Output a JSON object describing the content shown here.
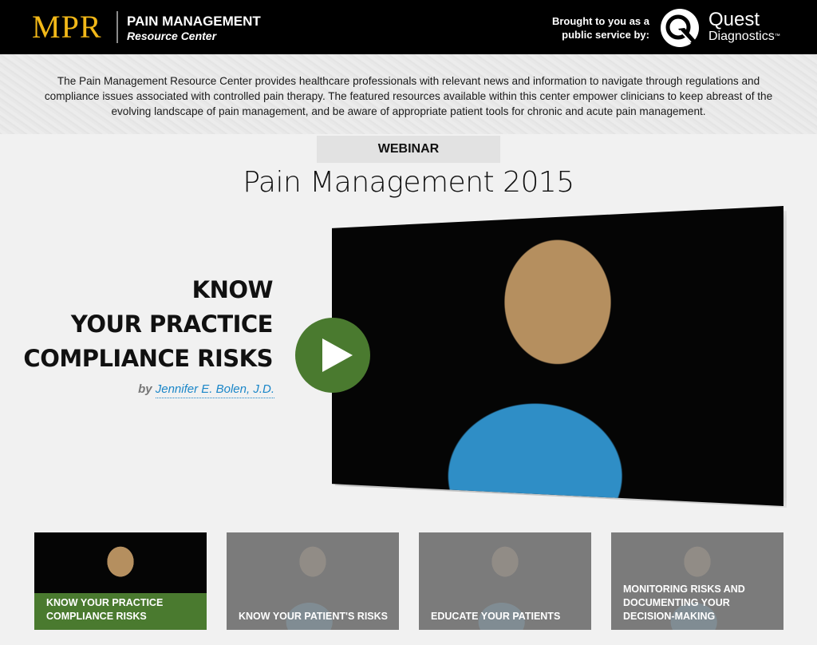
{
  "header": {
    "logo": "MPR",
    "title": "PAIN MANAGEMENT",
    "subtitle": "Resource Center",
    "sponsor_line1": "Brought to you as a",
    "sponsor_line2": "public service by:",
    "sponsor_name": "Quest",
    "sponsor_name2": "Diagnostics",
    "sponsor_tm": "™"
  },
  "intro": {
    "text": "The Pain Management Resource Center provides healthcare professionals with relevant news and information to navigate through regulations and compliance issues associated with controlled pain therapy.  The featured resources available within this center empower clinicians to keep abreast of the evolving landscape of pain management, and be aware of appropriate patient tools for chronic and acute pain management."
  },
  "webinar": {
    "tag": "WEBINAR",
    "title": "Pain Management 2015"
  },
  "feature": {
    "headline_line1": "KNOW",
    "headline_line2": "YOUR PRACTICE",
    "headline_line3": "COMPLIANCE RISKS",
    "by": "by",
    "author": "Jennifer E. Bolen, J.D."
  },
  "thumbnails": [
    {
      "label": "KNOW YOUR PRACTICE COMPLIANCE RISKS",
      "active": true
    },
    {
      "label": "KNOW YOUR PATIENT'S RISKS",
      "active": false
    },
    {
      "label": "EDUCATE YOUR PATIENTS",
      "active": false
    },
    {
      "label": "MONITORING RISKS AND DOCUMENTING YOUR DECISION-MAKING",
      "active": false
    }
  ],
  "colors": {
    "accent_green": "#4a7a2f",
    "logo_gold": "#f2b818",
    "author_link": "#1a86c8"
  }
}
